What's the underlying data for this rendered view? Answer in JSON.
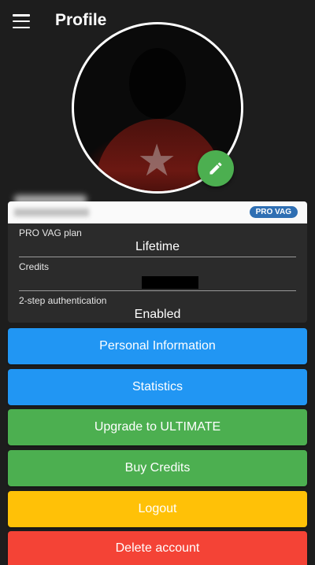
{
  "appbar": {
    "title": "Profile",
    "menu_icon": "hamburger-menu-icon",
    "edit_icon": "pencil-icon"
  },
  "account": {
    "plan_badge": "PRO VAG"
  },
  "details": [
    {
      "label": "PRO VAG plan",
      "value": "Lifetime"
    },
    {
      "label": "Credits",
      "value": ""
    },
    {
      "label": "2-step authentication",
      "value": "Enabled"
    }
  ],
  "buttons": {
    "personal_info": "Personal Information",
    "statistics": "Statistics",
    "upgrade": "Upgrade to ULTIMATE",
    "buy_credits": "Buy Credits",
    "logout": "Logout",
    "delete_account": "Delete account"
  },
  "colors": {
    "background": "#1d1d1d",
    "blue": "#2196f3",
    "green": "#4caf50",
    "amber": "#ffc107",
    "red": "#f44336",
    "badge": "#2f6fb3"
  }
}
